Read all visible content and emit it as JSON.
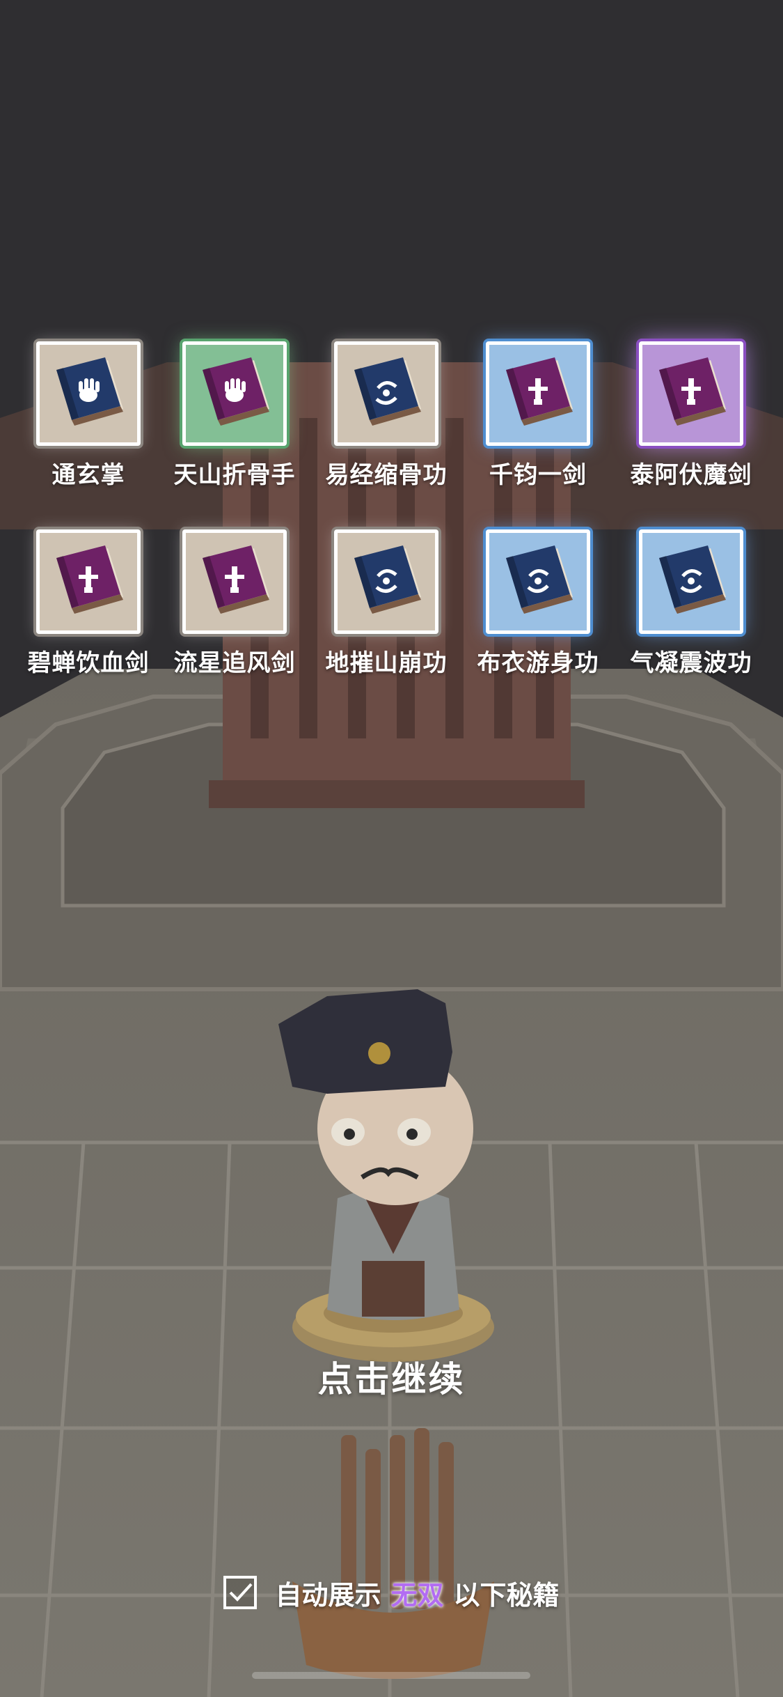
{
  "skills_row1": [
    {
      "name": "通玄掌",
      "rarity": "white",
      "cover": "#223a6a",
      "emblem": "palm"
    },
    {
      "name": "天山折骨手",
      "rarity": "green",
      "cover": "#6e2166",
      "emblem": "palm"
    },
    {
      "name": "易经缩骨功",
      "rarity": "white",
      "cover": "#223a6a",
      "emblem": "swirl"
    },
    {
      "name": "千钧一剑",
      "rarity": "blue",
      "cover": "#6e2166",
      "emblem": "sword"
    },
    {
      "name": "泰阿伏魔剑",
      "rarity": "purple",
      "cover": "#6e2166",
      "emblem": "sword"
    }
  ],
  "skills_row2": [
    {
      "name": "碧蝉饮血剑",
      "rarity": "white",
      "cover": "#6e2166",
      "emblem": "sword"
    },
    {
      "name": "流星追风剑",
      "rarity": "white",
      "cover": "#6e2166",
      "emblem": "sword"
    },
    {
      "name": "地摧山崩功",
      "rarity": "white",
      "cover": "#223a6a",
      "emblem": "swirl"
    },
    {
      "name": "布衣游身功",
      "rarity": "blue",
      "cover": "#223a6a",
      "emblem": "swirl"
    },
    {
      "name": "气凝震波功",
      "rarity": "blue",
      "cover": "#223a6a",
      "emblem": "swirl"
    }
  ],
  "continue_label": "点击继续",
  "auto_show": {
    "checked": true,
    "prefix": "自动展示",
    "tier": "无双",
    "suffix": "以下秘籍",
    "tier_color": "#b26cf2"
  }
}
